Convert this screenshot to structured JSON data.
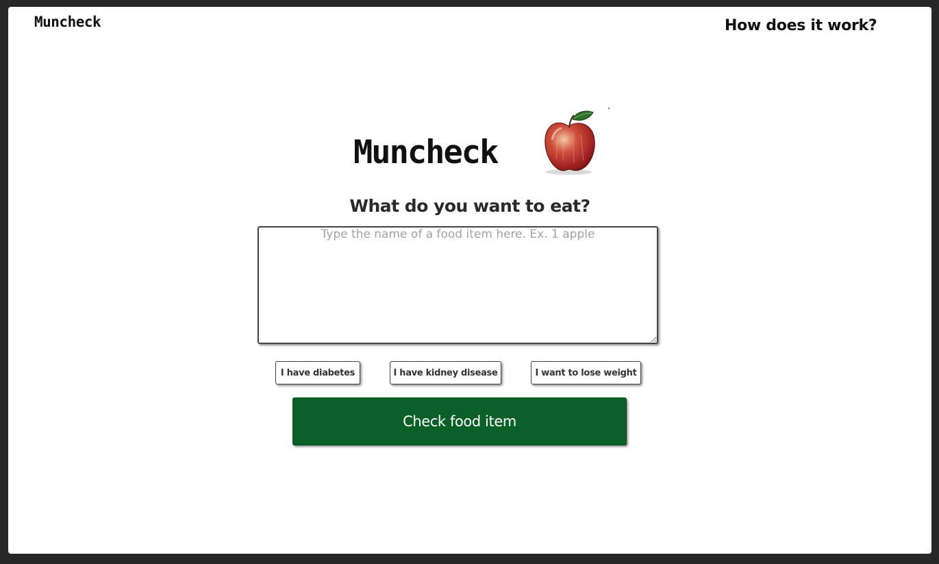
{
  "nav": {
    "logo": "Muncheck",
    "how_it_works": "How does it work?"
  },
  "hero": {
    "title": "Muncheck",
    "icon": "apple-icon"
  },
  "form": {
    "question": "What do you want to eat?",
    "food_input_placeholder": "Type the name of a food item here. Ex. 1 apple",
    "food_input_value": "",
    "options": [
      "I have diabetes",
      "I have kidney disease",
      "I want to lose weight"
    ],
    "submit_label": "Check food item"
  },
  "colors": {
    "page_bg": "#272727",
    "content_bg": "#ffffff",
    "primary_button": "#0a6027",
    "apple_red": "#c0392b",
    "leaf_green": "#2f6d2a"
  }
}
